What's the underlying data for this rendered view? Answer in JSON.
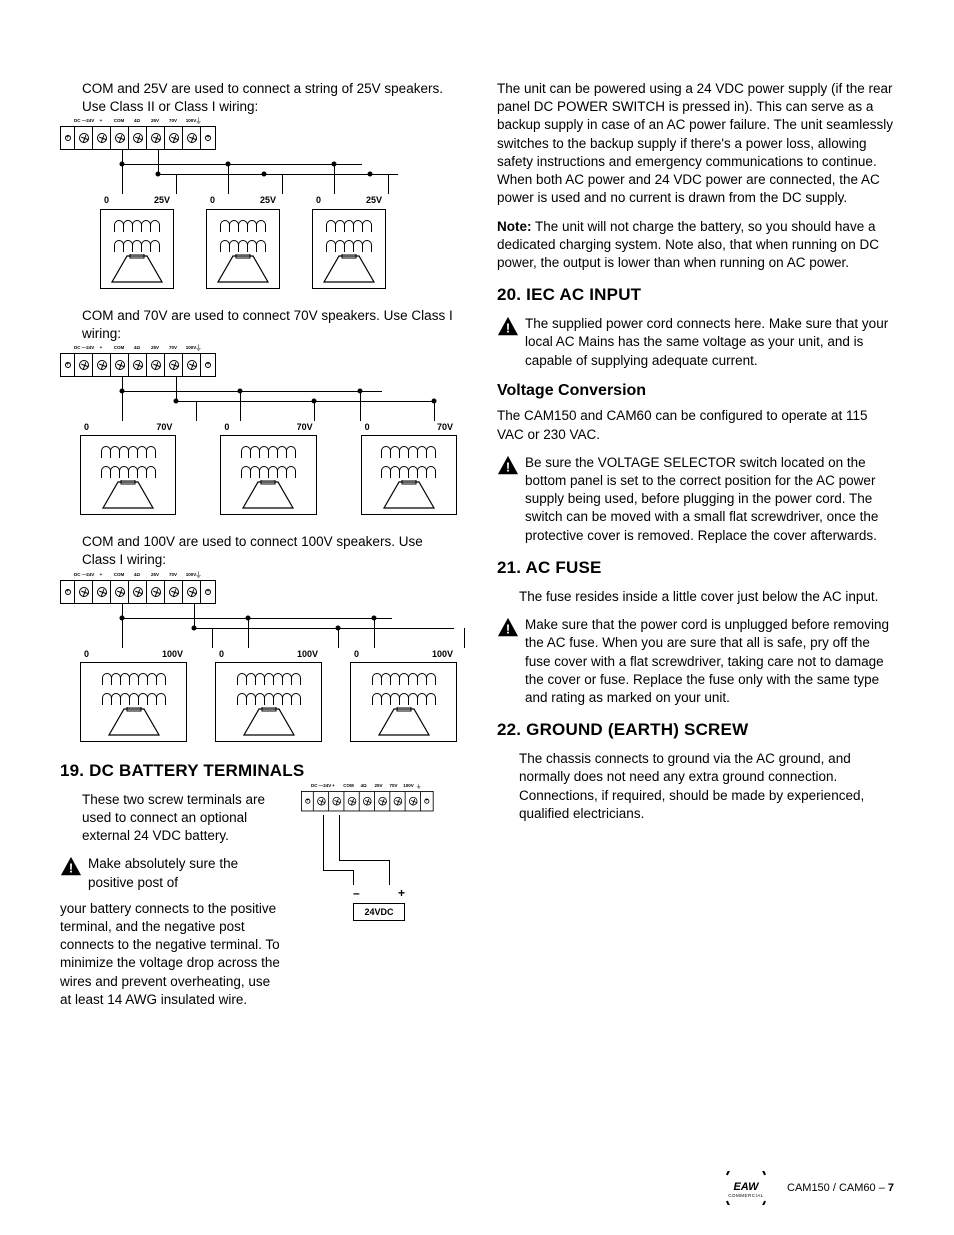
{
  "terminal_labels": [
    "DC —24V",
    "+",
    "COM",
    "4Ω",
    "25V",
    "70V",
    "100V"
  ],
  "col1": {
    "p1": "COM and 25V are used to connect a string of 25V speakers. Use Class II or Class I wiring:",
    "diag25": {
      "left": "0",
      "right": "25V"
    },
    "p2": "COM and 70V are used to connect 70V speakers. Use Class I wiring:",
    "diag70": {
      "left": "0",
      "right": "70V"
    },
    "p3": "COM and 100V are used to connect 100V speakers. Use Class I wiring:",
    "diag100": {
      "left": "0",
      "right": "100V"
    },
    "h19": "19. DC BATTERY TERMINALS",
    "p19a": "These two screw terminals are used to connect an optional external 24 VDC battery.",
    "w19_lead": "Make absolutely sure the positive post of ",
    "w19_rest": "your battery connects to the positive terminal, and the negative post connects to the negative terminal. To minimize the voltage drop across the wires and prevent overheating, use at least 14 AWG insulated wire.",
    "batt_minus": "–",
    "batt_plus": "+",
    "batt_label": "24VDC"
  },
  "col2": {
    "p_intro": "The unit can be powered using a 24 VDC power supply (if the rear panel DC POWER SWITCH is pressed in). This can serve as a backup supply in case of an AC power failure. The unit seamlessly switches to the backup supply if there's a power loss, allowing safety instructions and emergency communications to continue. When both AC power and 24 VDC power are connected, the AC power is used and no current is drawn from the DC supply.",
    "note_label": "Note:",
    "note_body": " The unit will not charge the battery, so you should have a dedicated charging system. Note also, that when running on DC power, the output is lower than when running on AC power.",
    "h20": "20. IEC AC INPUT",
    "w20": "The supplied power cord connects here. Make sure that your local AC Mains has the same voltage as your unit, and is capable of supplying adequate current.",
    "h_vc": "Voltage Conversion",
    "p_vc": "The CAM150 and CAM60 can be configured to operate at 115 VAC or 230 VAC.",
    "w_vc": "Be sure the VOLTAGE SELECTOR switch located on the bottom panel is set to the correct position for the AC power supply being used, before plugging in the power cord. The switch can be moved with a small flat screwdriver, once the protective cover is removed. Replace the cover afterwards.",
    "h21": "21. AC FUSE",
    "p21": "The fuse resides inside a little cover just below the AC input.",
    "w21": "Make sure that the power cord is unplugged before removing the AC fuse. When you are sure that all is safe, pry off the fuse cover with a flat screwdriver, taking care not to damage the cover or fuse. Replace the fuse only with the same type and rating as marked on your unit.",
    "h22": "22. GROUND (EARTH) SCREW",
    "p22": "The chassis connects to ground via the AC ground, and normally does not need any extra ground connection. Connections, if required, should be made by experienced, qualified electricians."
  },
  "footer": {
    "model": "CAM150 / CAM60 – ",
    "page": "7",
    "brand_top": "EAW",
    "brand_bot": "COMMERCIAL"
  }
}
